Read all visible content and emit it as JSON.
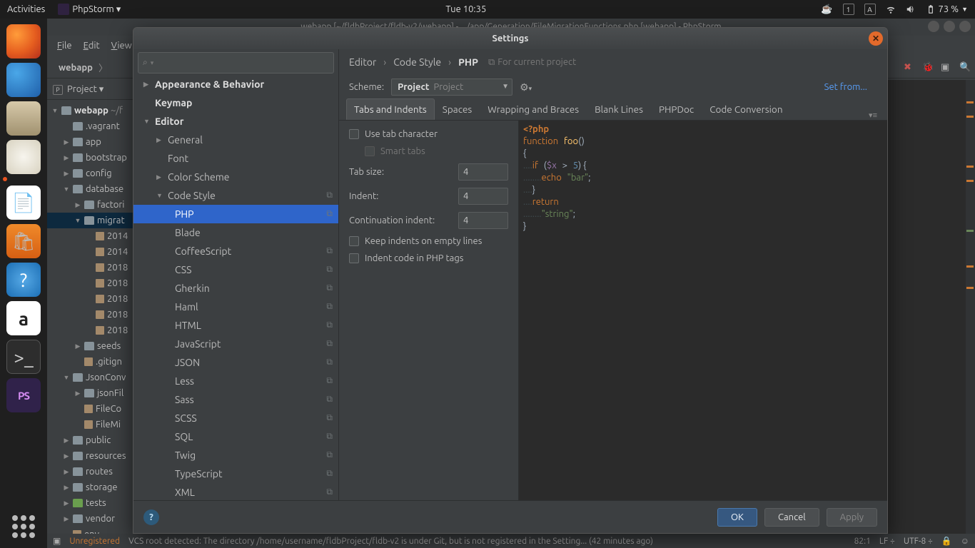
{
  "gnome": {
    "activities": "Activities",
    "app_menu": "PhpStorm ▾",
    "clock": "Tue 10:35",
    "battery": "73 %"
  },
  "dock": {
    "apps": [
      "firefox",
      "thunderbird",
      "files",
      "rhythmbox",
      "libreoffice",
      "software",
      "help",
      "amazon",
      "terminal",
      "phpstorm"
    ]
  },
  "ide": {
    "title": "webapp [~/fldbProject/fldb-v2/webapp] - .../app/Generation/FileMigrationFunctions.php [webapp] - PhpStorm",
    "menu": [
      "File",
      "Edit",
      "View"
    ],
    "breadcrumb": "webapp",
    "project_label": "Project ▾",
    "tree": [
      {
        "d": 0,
        "a": "▼",
        "icon": "folder",
        "bold": true,
        "label": "webapp",
        "suffix": " ~/f"
      },
      {
        "d": 1,
        "a": "",
        "icon": "folder",
        "label": ".vagrant"
      },
      {
        "d": 1,
        "a": "▶",
        "icon": "folder",
        "label": "app"
      },
      {
        "d": 1,
        "a": "▶",
        "icon": "folder",
        "label": "bootstrap"
      },
      {
        "d": 1,
        "a": "▶",
        "icon": "folder",
        "label": "config"
      },
      {
        "d": 1,
        "a": "▼",
        "icon": "folder",
        "label": "database"
      },
      {
        "d": 2,
        "a": "▶",
        "icon": "folder",
        "label": "factori"
      },
      {
        "d": 2,
        "a": "▼",
        "icon": "folder",
        "label": "migrat",
        "sel": true
      },
      {
        "d": 3,
        "a": "",
        "icon": "file",
        "label": "2014"
      },
      {
        "d": 3,
        "a": "",
        "icon": "file",
        "label": "2014"
      },
      {
        "d": 3,
        "a": "",
        "icon": "file",
        "label": "2018"
      },
      {
        "d": 3,
        "a": "",
        "icon": "file",
        "label": "2018"
      },
      {
        "d": 3,
        "a": "",
        "icon": "file",
        "label": "2018"
      },
      {
        "d": 3,
        "a": "",
        "icon": "file",
        "label": "2018"
      },
      {
        "d": 3,
        "a": "",
        "icon": "file",
        "label": "2018"
      },
      {
        "d": 2,
        "a": "▶",
        "icon": "folder",
        "label": "seeds"
      },
      {
        "d": 2,
        "a": "",
        "icon": "file",
        "label": ".gitign"
      },
      {
        "d": 1,
        "a": "▼",
        "icon": "folder",
        "label": "JsonConv"
      },
      {
        "d": 2,
        "a": "▶",
        "icon": "folder",
        "label": "jsonFil"
      },
      {
        "d": 2,
        "a": "",
        "icon": "file",
        "label": "FileCo"
      },
      {
        "d": 2,
        "a": "",
        "icon": "file",
        "label": "FileMi"
      },
      {
        "d": 1,
        "a": "▶",
        "icon": "folder",
        "label": "public"
      },
      {
        "d": 1,
        "a": "▶",
        "icon": "folder",
        "label": "resources"
      },
      {
        "d": 1,
        "a": "▶",
        "icon": "folder",
        "label": "routes"
      },
      {
        "d": 1,
        "a": "▶",
        "icon": "folder",
        "label": "storage"
      },
      {
        "d": 1,
        "a": "▶",
        "icon": "green",
        "label": "tests"
      },
      {
        "d": 1,
        "a": "▶",
        "icon": "folder",
        "label": "vendor"
      },
      {
        "d": 1,
        "a": "",
        "icon": "file",
        "label": "env"
      }
    ],
    "status_warn": "Unregistered",
    "status_msg": "VCS root detected: The directory /home/username/fldbProject/fldb-v2 is under Git, but is not registered in the Setting... (42 minutes ago)",
    "status_right": [
      "82:1",
      "LF ÷",
      "UTF-8 ÷"
    ]
  },
  "dialog": {
    "title": "Settings",
    "search_icon": "⌕",
    "tree": [
      {
        "lvl": 0,
        "ar": "▶",
        "label": "Appearance & Behavior",
        "bold": true
      },
      {
        "lvl": 0,
        "ar": "",
        "label": "Keymap",
        "bold": true
      },
      {
        "lvl": 0,
        "ar": "▼",
        "label": "Editor",
        "bold": true
      },
      {
        "lvl": 1,
        "ar": "▶",
        "label": "General"
      },
      {
        "lvl": 1,
        "ar": "",
        "label": "Font"
      },
      {
        "lvl": 1,
        "ar": "▶",
        "label": "Color Scheme"
      },
      {
        "lvl": 1,
        "ar": "▼",
        "label": "Code Style",
        "badge": "⧉"
      },
      {
        "lvl": 2,
        "label": "PHP",
        "sel": true,
        "badge": "⧉"
      },
      {
        "lvl": 2,
        "label": "Blade"
      },
      {
        "lvl": 2,
        "label": "CoffeeScript",
        "badge": "⧉"
      },
      {
        "lvl": 2,
        "label": "CSS",
        "badge": "⧉"
      },
      {
        "lvl": 2,
        "label": "Gherkin",
        "badge": "⧉"
      },
      {
        "lvl": 2,
        "label": "Haml",
        "badge": "⧉"
      },
      {
        "lvl": 2,
        "label": "HTML",
        "badge": "⧉"
      },
      {
        "lvl": 2,
        "label": "JavaScript",
        "badge": "⧉"
      },
      {
        "lvl": 2,
        "label": "JSON",
        "badge": "⧉"
      },
      {
        "lvl": 2,
        "label": "Less",
        "badge": "⧉"
      },
      {
        "lvl": 2,
        "label": "Sass",
        "badge": "⧉"
      },
      {
        "lvl": 2,
        "label": "SCSS",
        "badge": "⧉"
      },
      {
        "lvl": 2,
        "label": "SQL",
        "badge": "⧉"
      },
      {
        "lvl": 2,
        "label": "Twig",
        "badge": "⧉"
      },
      {
        "lvl": 2,
        "label": "TypeScript",
        "badge": "⧉"
      },
      {
        "lvl": 2,
        "label": "XML",
        "badge": "⧉"
      }
    ],
    "crumbs": {
      "a": "Editor",
      "b": "Code Style",
      "c": "PHP",
      "hint": "For current project"
    },
    "scheme_label": "Scheme:",
    "scheme_value": "Project",
    "scheme_sub": "Project",
    "setfrom": "Set from...",
    "tabs": [
      "Tabs and Indents",
      "Spaces",
      "Wrapping and Braces",
      "Blank Lines",
      "PHPDoc",
      "Code Conversion"
    ],
    "opts": {
      "use_tab": "Use tab character",
      "smart": "Smart tabs",
      "tab_size_label": "Tab size:",
      "tab_size": "4",
      "indent_label": "Indent:",
      "indent": "4",
      "cont_label": "Continuation indent:",
      "cont": "4",
      "keep": "Keep indents on empty lines",
      "phptags": "Indent code in PHP tags"
    },
    "buttons": {
      "ok": "OK",
      "cancel": "Cancel",
      "apply": "Apply"
    }
  }
}
